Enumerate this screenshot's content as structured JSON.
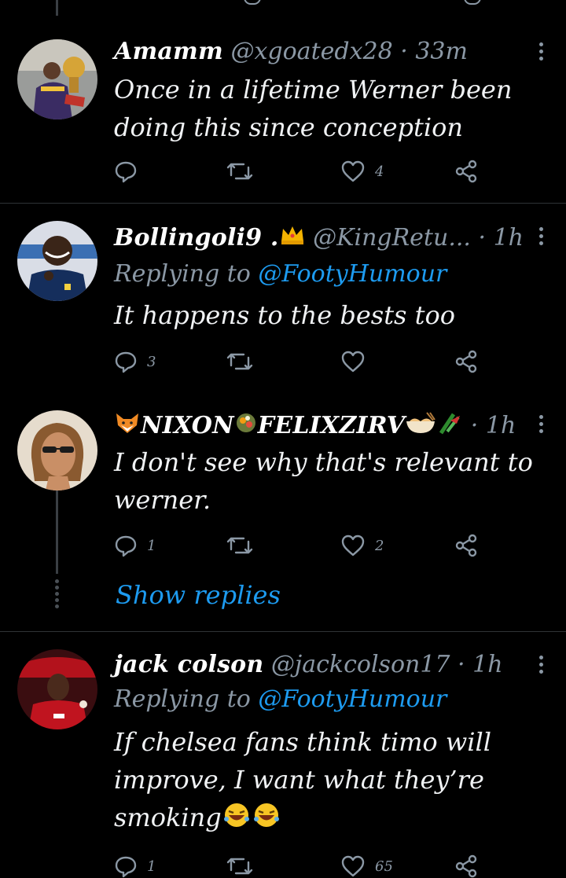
{
  "colors": {
    "background": "#000000",
    "text": "#e7e9ea",
    "secondary": "#8b98a5",
    "link": "#1d9bf0",
    "divider": "#2f3336"
  },
  "tweets": [
    {
      "name": "Amamm",
      "handle": "@xgoatedx28",
      "separator": "·",
      "time": "33m",
      "body": "Once in a lifetime Werner been\ndoing this since conception",
      "reply_count": "",
      "retweet_count": "",
      "like_count": "4",
      "avatar_icon": "basketball-player-avatar"
    },
    {
      "name": "Bollingoli9 .",
      "handle": "@KingRetu...",
      "separator": "·",
      "time": "1h",
      "replying_prefix": "Replying to",
      "replying_to": "@FootyHumour",
      "body": "It happens to the bests too",
      "reply_count": "3",
      "retweet_count": "",
      "like_count": "",
      "name_emoji": "crown-emoji",
      "avatar_icon": "chelsea-player-avatar"
    },
    {
      "name": "NIXON",
      "name_part2": "FELIXZIRV",
      "separator": "·",
      "time": "1h",
      "body": "I don't see why that's relevant to\nwerner.",
      "reply_count": "1",
      "retweet_count": "",
      "like_count": "2",
      "show_replies": "Show replies",
      "name_emojis": [
        "fox-emoji",
        "food-emoji",
        "ramen-emoji",
        "bamboo-emoji"
      ],
      "avatar_icon": "man-sunglasses-avatar"
    },
    {
      "name": "jack colson",
      "handle": "@jackcolson17",
      "separator": "·",
      "time": "1h",
      "replying_prefix": "Replying to",
      "replying_to": "@FootyHumour",
      "body": "If chelsea fans think timo will\nimprove, I want what they’re\nsmoking",
      "reply_count": "1",
      "retweet_count": "",
      "like_count": "65",
      "body_emojis": [
        "laughing-emoji",
        "laughing-emoji"
      ],
      "avatar_icon": "united-player-avatar"
    }
  ]
}
